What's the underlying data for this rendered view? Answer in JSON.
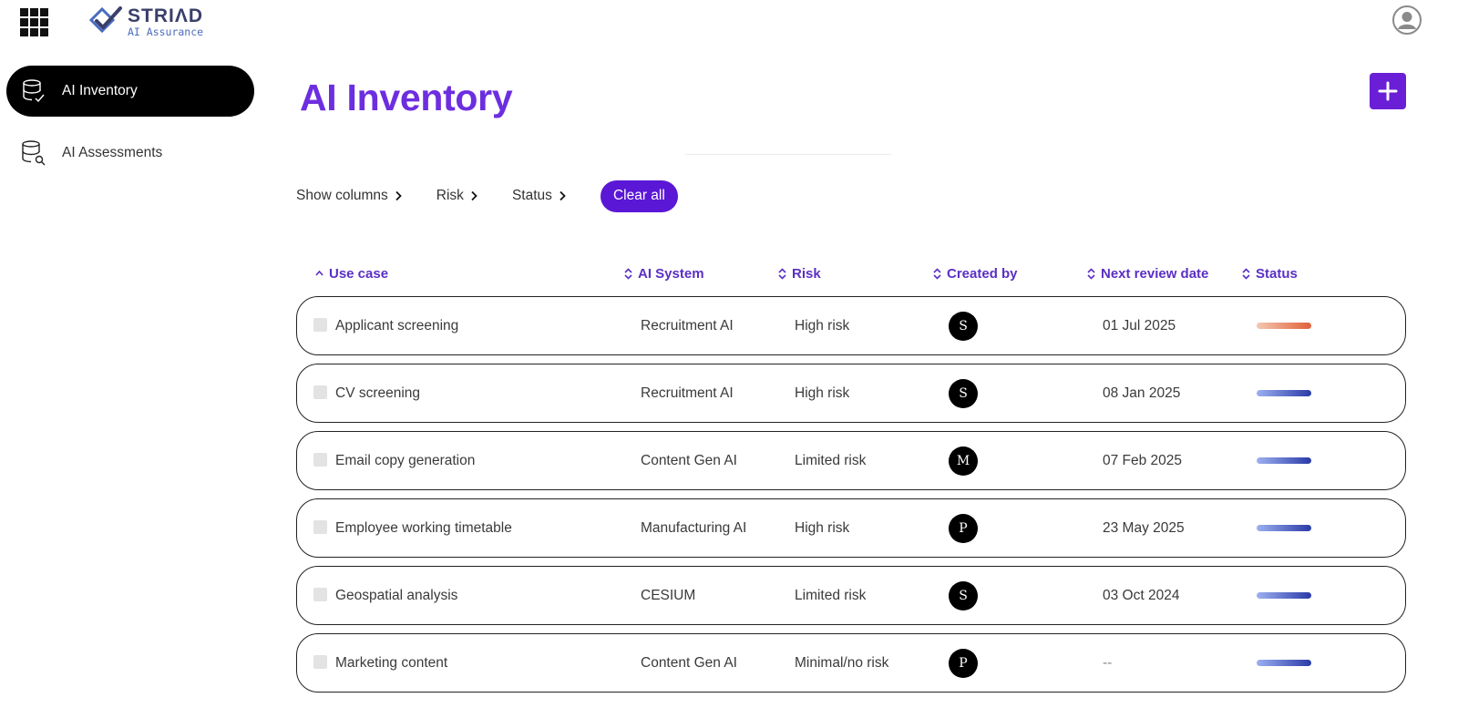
{
  "app": {
    "name": "STRIΛD",
    "subtitle": "AI Assurance",
    "grid_icon": "apps-grid-icon",
    "user_icon": "user-account-icon"
  },
  "sidebar": {
    "items": [
      {
        "label": "AI Inventory",
        "icon": "database-check-icon",
        "active": true
      },
      {
        "label": "AI Assessments",
        "icon": "database-search-icon",
        "active": false
      }
    ]
  },
  "main": {
    "title": "AI Inventory",
    "add_icon": "plus-icon"
  },
  "filters": {
    "show_columns": "Show columns",
    "risk": "Risk",
    "status": "Status",
    "clear_all": "Clear all"
  },
  "table": {
    "columns": [
      {
        "label": "Use case",
        "sort": "ascending"
      },
      {
        "label": "AI System",
        "sort": "none"
      },
      {
        "label": "Risk",
        "sort": "none"
      },
      {
        "label": "Created by",
        "sort": "none"
      },
      {
        "label": "Next review date",
        "sort": "none"
      },
      {
        "label": "Status",
        "sort": "none"
      }
    ],
    "rows": [
      {
        "use_case": "Applicant screening",
        "ai_system": "Recruitment AI",
        "risk": "High risk",
        "created_by": "S",
        "next_review": "01 Jul 2025",
        "status_color": "orange"
      },
      {
        "use_case": "CV screening",
        "ai_system": "Recruitment AI",
        "risk": "High risk",
        "created_by": "S",
        "next_review": "08 Jan 2025",
        "status_color": "blue"
      },
      {
        "use_case": "Email copy generation",
        "ai_system": "Content Gen AI",
        "risk": "Limited risk",
        "created_by": "M",
        "next_review": "07 Feb 2025",
        "status_color": "blue"
      },
      {
        "use_case": "Employee working timetable",
        "ai_system": "Manufacturing AI",
        "risk": "High risk",
        "created_by": "P",
        "next_review": "23 May 2025",
        "status_color": "blue"
      },
      {
        "use_case": "Geospatial analysis",
        "ai_system": "CESIUM",
        "risk": "Limited risk",
        "created_by": "S",
        "next_review": "03 Oct 2024",
        "status_color": "blue"
      },
      {
        "use_case": "Marketing content",
        "ai_system": "Content Gen AI",
        "risk": "Minimal/no risk",
        "created_by": "P",
        "next_review": "--",
        "status_color": "blue"
      }
    ]
  },
  "colors": {
    "accent": "#6d2ee0",
    "button": "#6a1fd6",
    "status_orange": "#e0603a",
    "status_blue": "#2a3aa8"
  }
}
